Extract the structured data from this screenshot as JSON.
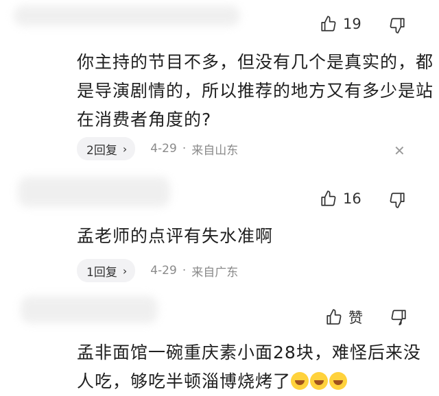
{
  "comments": [
    {
      "likes": "19",
      "text": "你主持的节目不多，但没有几个是真实的，都是导演剧情的，所以推荐的地方又有多少是站在消费者角度的?",
      "replies": "2回复",
      "date": "4-29",
      "sep": "·",
      "location": "来自山东"
    },
    {
      "likes": "16",
      "text": "孟老师的点评有失水准啊",
      "replies": "1回复",
      "date": "4-29",
      "sep": "·",
      "location": "来自广东"
    },
    {
      "likes": "赞",
      "text": "孟非面馆一碗重庆素小面28块，难怪后来没人吃，够吃半顿淄博烧烤了"
    }
  ],
  "icons": {
    "like": "thumbs-up-icon",
    "dislike": "thumbs-down-icon",
    "close": "close-icon",
    "chevron": "chevron-right-icon",
    "emoji": "laughing-tears-emoji"
  },
  "glyphs": {
    "close": "✕",
    "chevron": "›"
  }
}
